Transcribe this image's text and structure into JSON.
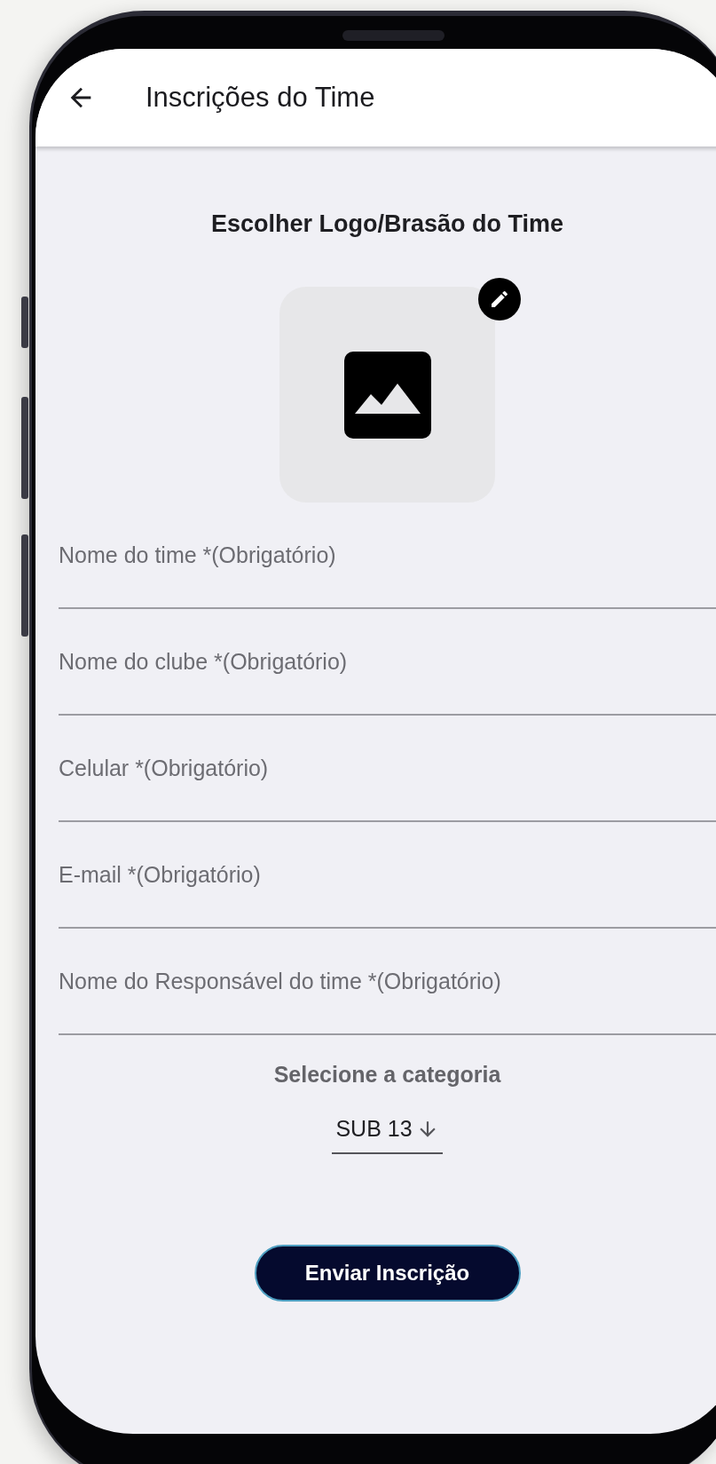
{
  "header": {
    "title": "Inscrições do Time"
  },
  "logo_picker": {
    "heading": "Escolher Logo/Brasão do Time"
  },
  "fields": [
    {
      "placeholder": "Nome do time *(Obrigatório)"
    },
    {
      "placeholder": "Nome do clube *(Obrigatório)"
    },
    {
      "placeholder": "Celular *(Obrigatório)"
    },
    {
      "placeholder": "E-mail *(Obrigatório)"
    },
    {
      "placeholder": "Nome do Responsável do time *(Obrigatório)"
    }
  ],
  "category": {
    "label": "Selecione a categoria",
    "value": "SUB 13"
  },
  "submit_button": "Enviar Inscrição"
}
